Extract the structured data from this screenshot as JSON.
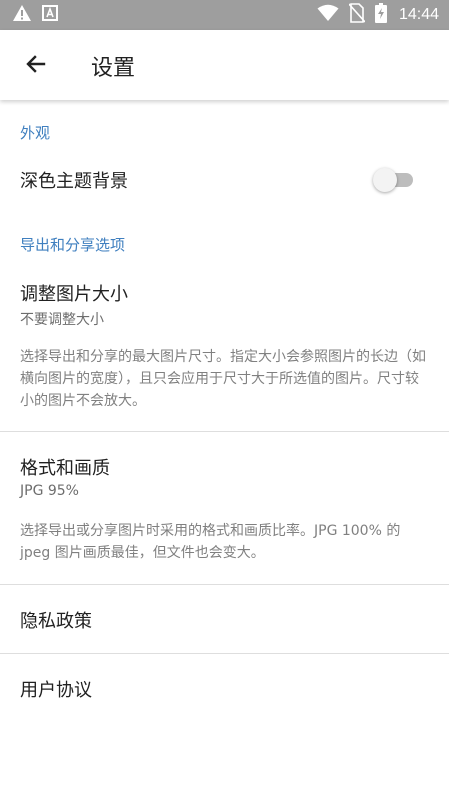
{
  "status_bar": {
    "time": "14:44",
    "left_icons": [
      "warning-icon",
      "a-badge-icon"
    ],
    "right_icons": [
      "wifi-icon",
      "no-sim-icon",
      "battery-charging-icon"
    ],
    "background": "#9e9e9e"
  },
  "app_bar": {
    "title": "设置",
    "back_icon": "arrow-left-icon"
  },
  "sections": {
    "appearance": {
      "header": "外观",
      "dark_theme": {
        "label": "深色主题背景",
        "enabled": false
      }
    },
    "export": {
      "header": "导出和分享选项",
      "resize": {
        "title": "调整图片大小",
        "value": "不要调整大小",
        "description": "选择导出和分享的最大图片尺寸。指定大小会参照图片的长边（如横向图片的宽度），且只会应用于尺寸大于所选值的图片。尺寸较小的图片不会放大。"
      },
      "format": {
        "title": "格式和画质",
        "value": "JPG 95%",
        "description": "选择导出或分享图片时采用的格式和画质比率。JPG 100% 的 jpeg 图片画质最佳，但文件也会变大。"
      }
    },
    "privacy": {
      "title": "隐私政策"
    },
    "agreement": {
      "title": "用户协议"
    }
  },
  "colors": {
    "accent": "#3f7fbf",
    "primary_text": "#212121",
    "secondary_text": "#6d6d6d",
    "divider": "#dedede"
  }
}
